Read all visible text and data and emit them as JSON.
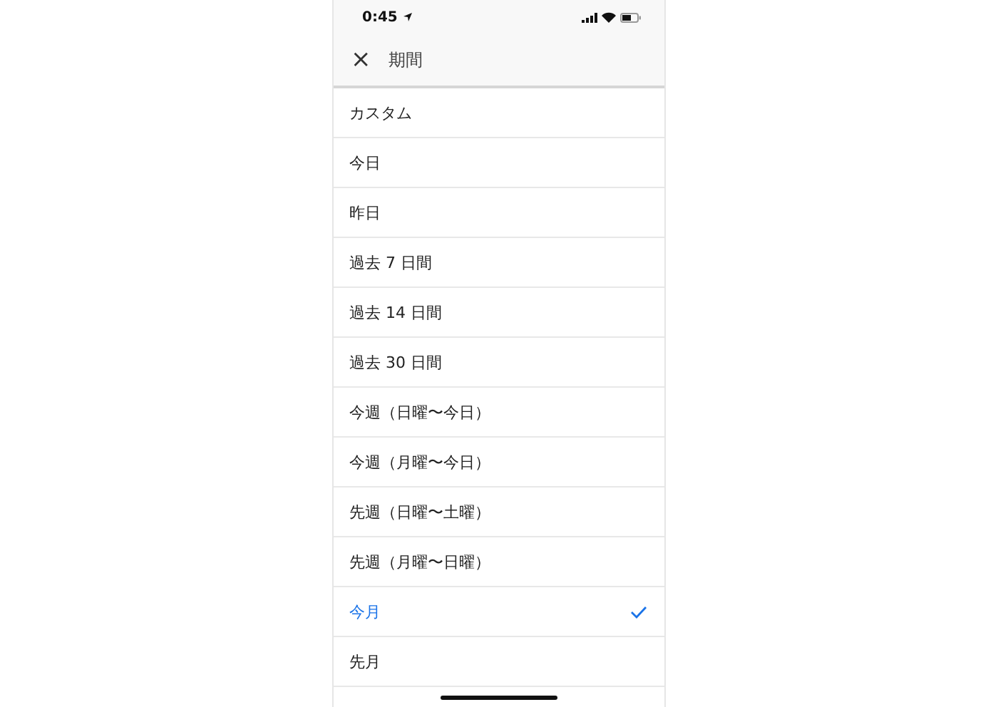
{
  "status_bar": {
    "time": "0:45"
  },
  "header": {
    "close": "×",
    "title": "期間"
  },
  "options": [
    {
      "label": "カスタム",
      "selected": false
    },
    {
      "label": "今日",
      "selected": false
    },
    {
      "label": "昨日",
      "selected": false
    },
    {
      "label": "過去 7 日間",
      "selected": false
    },
    {
      "label": "過去 14 日間",
      "selected": false
    },
    {
      "label": "過去 30 日間",
      "selected": false
    },
    {
      "label": "今週（日曜〜今日）",
      "selected": false
    },
    {
      "label": "今週（月曜〜今日）",
      "selected": false
    },
    {
      "label": "先週（日曜〜土曜）",
      "selected": false
    },
    {
      "label": "先週（月曜〜日曜）",
      "selected": false
    },
    {
      "label": "今月",
      "selected": true
    },
    {
      "label": "先月",
      "selected": false
    }
  ]
}
